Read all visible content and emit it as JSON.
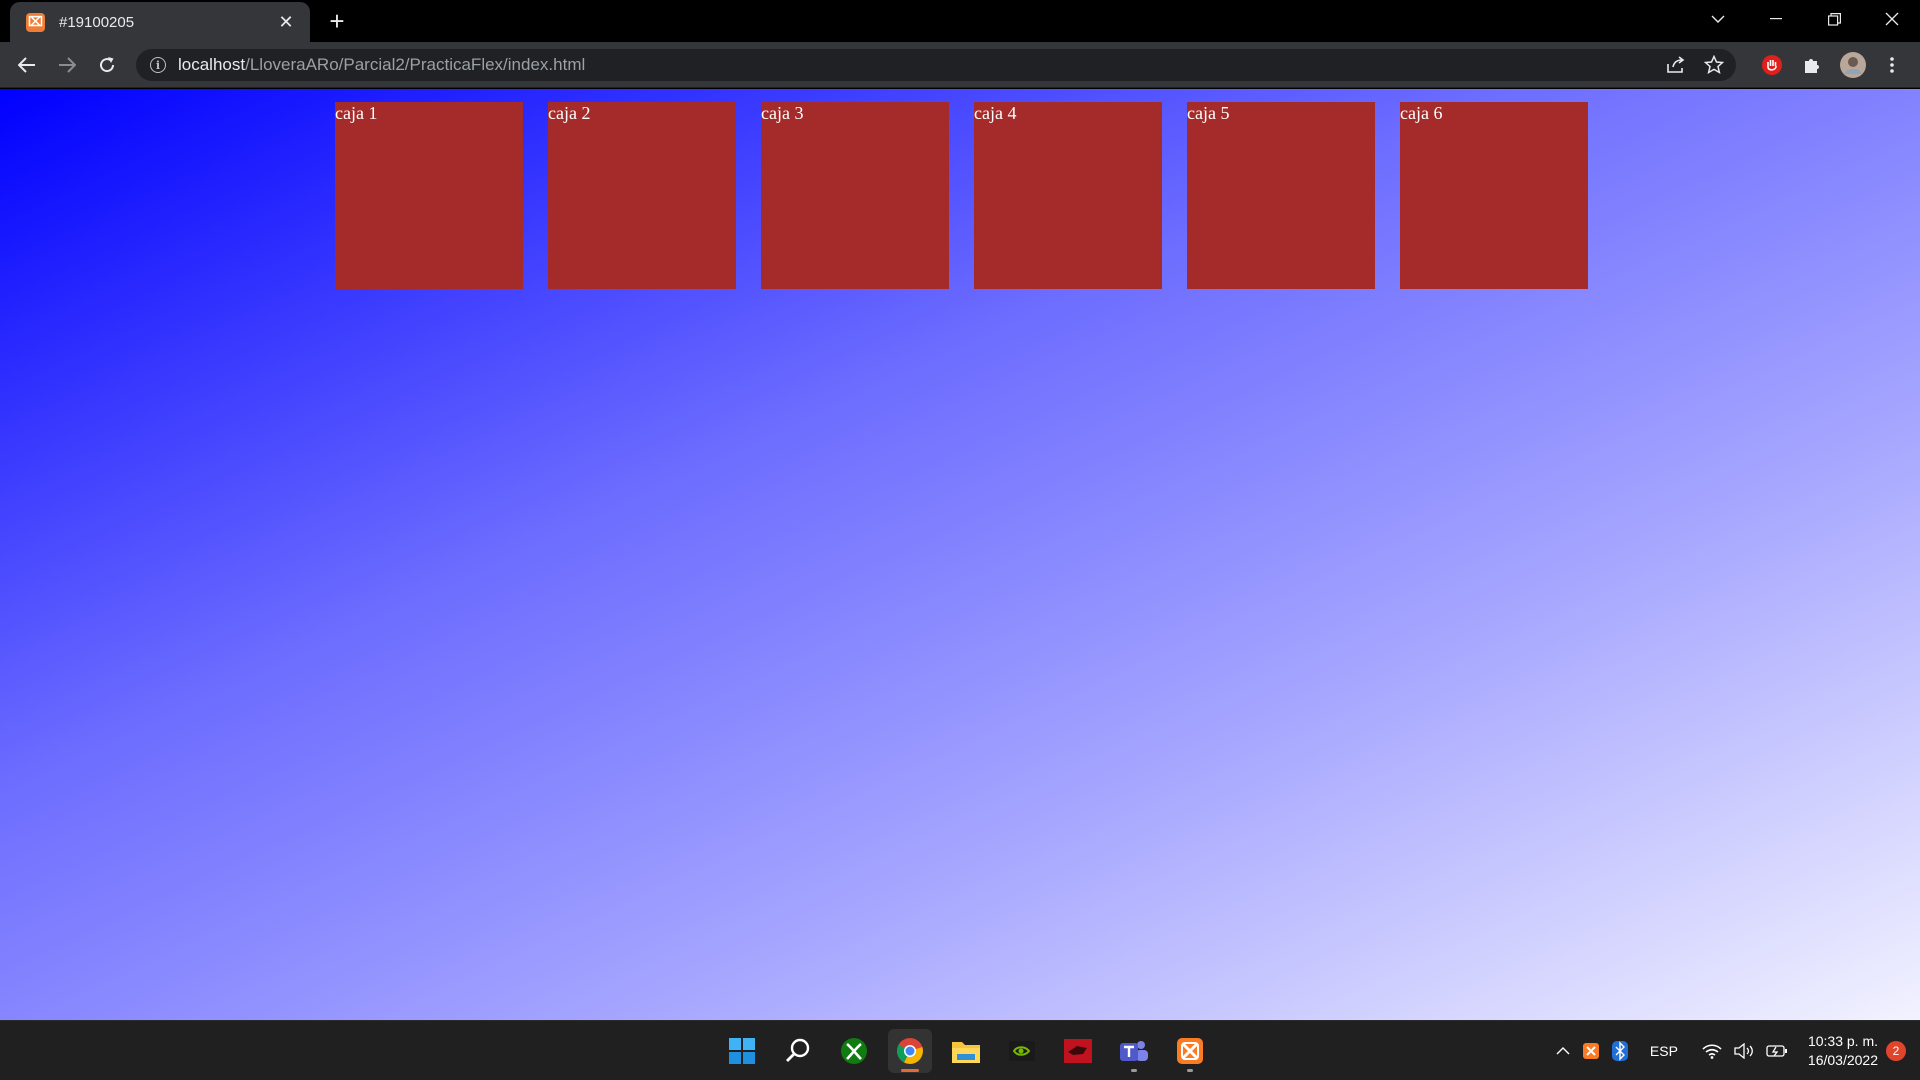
{
  "browser": {
    "tab": {
      "title": "#19100205",
      "favicon": "xampp-icon"
    },
    "url": {
      "host": "localhost",
      "path": "/LloveraARo/Parcial2/PracticaFlex/index.html"
    }
  },
  "page": {
    "boxes": [
      {
        "label": "caja 1"
      },
      {
        "label": "caja 2"
      },
      {
        "label": "caja 3"
      },
      {
        "label": "caja 4"
      },
      {
        "label": "caja 5"
      },
      {
        "label": "caja 6"
      }
    ],
    "colors": {
      "box": "#a52a2a",
      "gradient_start": "#0000ff",
      "gradient_end": "#f2f2ff"
    }
  },
  "taskbar": {
    "apps": [
      "windows-start-icon",
      "search-icon",
      "xbox-icon",
      "chrome-icon",
      "file-explorer-icon",
      "nvidia-icon",
      "red-app-icon",
      "teams-icon",
      "xampp-icon"
    ],
    "tray": {
      "language": "ESP",
      "time": "10:33 p. m.",
      "date": "16/03/2022",
      "notifications": "2"
    }
  }
}
